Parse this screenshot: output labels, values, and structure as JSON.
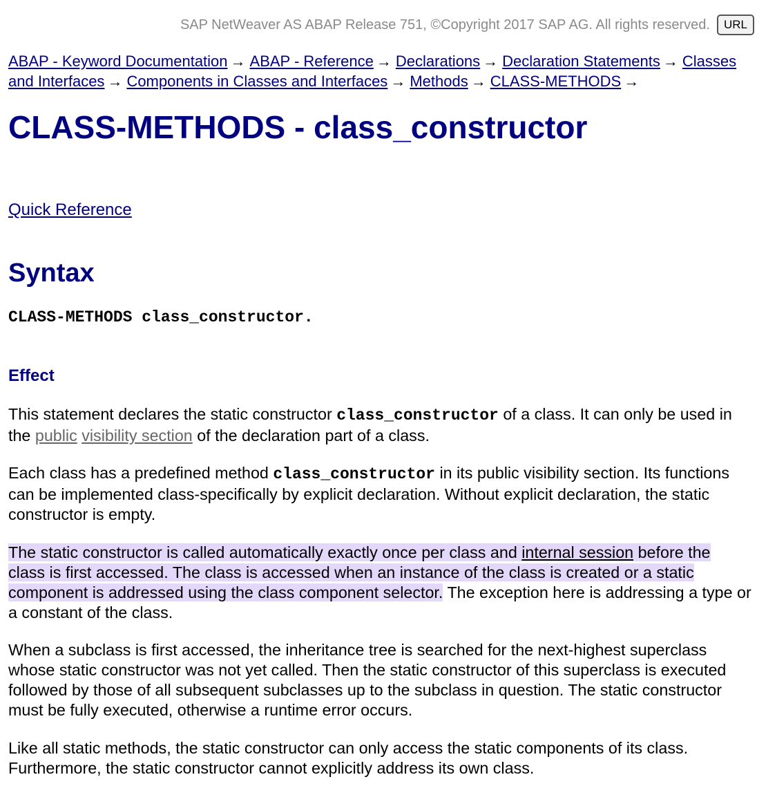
{
  "header": {
    "copyright": "SAP NetWeaver AS ABAP Release 751, ©Copyright 2017 SAP AG. All rights reserved.",
    "url_button": "URL"
  },
  "breadcrumb": {
    "items": [
      "ABAP - Keyword Documentation",
      "ABAP - Reference",
      "Declarations",
      "Declaration Statements",
      "Classes and Interfaces",
      "Components in Classes and Interfaces",
      "Methods",
      "CLASS-METHODS"
    ],
    "separator": "→"
  },
  "title": "CLASS-METHODS - class_constructor",
  "quick_reference": "Quick Reference",
  "syntax": {
    "heading": "Syntax",
    "code": "CLASS-METHODS class_constructor."
  },
  "effect": {
    "heading": "Effect",
    "p1": {
      "t1": "This statement declares the static constructor ",
      "code": "class_constructor",
      "t2": " of a class. It can only be used in the ",
      "link1": "public",
      "space": " ",
      "link2": "visibility section",
      "t3": " of the declaration part of a class."
    },
    "p2": {
      "t1": "Each class has a predefined method ",
      "code": "class_constructor",
      "t2": " in its public visibility section. Its functions can be implemented class-specifically by explicit declaration. Without explicit declaration, the static constructor is empty."
    },
    "p3": {
      "hl1": "The static constructor is called automatically exactly once per class and ",
      "link": "internal session",
      "hl2": " before the class is first accessed. The class is accessed when an instance of the class is created or a static component is addressed using the class component selector.",
      "t": " The exception here is addressing a type or a constant of the class."
    },
    "p4": "When a subclass is first accessed, the inheritance tree is searched for the next-highest superclass whose static constructor was not yet called. Then the static constructor of this superclass is executed followed by those of all subsequent subclasses up to the subclass in question. The static constructor must be fully executed, otherwise a runtime error occurs.",
    "p5": "Like all static methods, the static constructor can only access the static components of its class. Furthermore, the static constructor cannot explicitly address its own class."
  },
  "colors": {
    "heading": "#000080",
    "link": "#000080",
    "highlight": "#e4d8fa",
    "copyright": "#8a8a8a"
  }
}
